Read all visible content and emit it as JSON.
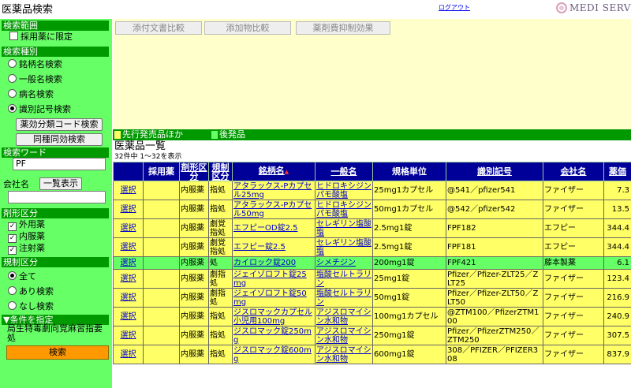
{
  "app": {
    "title": "医薬品検索",
    "logout": "ログアウト",
    "logo": "MEDI SERVE II"
  },
  "sidebar": {
    "scope": {
      "heading": "検索範囲",
      "adopted_only": "採用薬に限定"
    },
    "search_type": {
      "heading": "検索種別",
      "options": [
        "銘柄名検索",
        "一般名検索",
        "病名検索",
        "識別記号検索"
      ],
      "selected": "識別記号検索",
      "btn_efficacy": "薬効分類コード検索",
      "btn_same_kind": "同種同効検索"
    },
    "keyword": {
      "heading": "検索ワード",
      "value": "PF"
    },
    "company": {
      "label": "会社名",
      "btn_list": "一覧表示",
      "value": ""
    },
    "dosage_form": {
      "heading": "剤形区分",
      "options": [
        "外用薬",
        "内服薬",
        "注射薬"
      ]
    },
    "regulation": {
      "heading": "規制区分",
      "options": [
        "全て",
        "あり検索",
        "なし検索"
      ],
      "selected": "全て"
    },
    "conditions": {
      "heading": "▼条件を指定",
      "text": "局生特毒劇向覚麻習指要処"
    },
    "search_button": "検索"
  },
  "compare": {
    "buttons": [
      "添付文書比較",
      "添加物比較",
      "薬剤費抑制効果"
    ]
  },
  "legend": {
    "first_gen": "先行発売品ほか",
    "generic": "後発品",
    "first_gen_color": "#ffff66",
    "generic_color": "#66ff66"
  },
  "list": {
    "title": "医薬品一覧",
    "count": "32件中 1～32を表示"
  },
  "table": {
    "headers": {
      "select": "",
      "adopted": "採用薬",
      "form": "剤形区分",
      "regulation": "規制区分",
      "brand": "銘柄名",
      "generic": "一般名",
      "unit": "規格単位",
      "code": "識別記号",
      "company": "会社名",
      "price": "薬価"
    },
    "select_label": "選択",
    "rows": [
      {
        "form": "内服薬",
        "reg": "指処",
        "brand": "アタラックス-Pカプセル25mg",
        "generic": "ヒドロキシジンパモ酸塩",
        "unit": "25mg1カプセル",
        "code": "@541／pfizer541",
        "company": "ファイザー",
        "price": "7.3",
        "generic_flag": false
      },
      {
        "form": "内服薬",
        "reg": "指処",
        "brand": "アタラックス-Pカプセル50mg",
        "generic": "ヒドロキシジンパモ酸塩",
        "unit": "50mg1カプセル",
        "code": "@542／pfizer542",
        "company": "ファイザー",
        "price": "13.5",
        "generic_flag": false
      },
      {
        "form": "内服薬",
        "reg": "劇覚指処",
        "brand": "エフピーOD錠2.5",
        "generic": "セレギリン塩酸塩",
        "unit": "2.5mg1錠",
        "code": "FPF182",
        "company": "エフピー",
        "price": "344.4",
        "generic_flag": false
      },
      {
        "form": "内服薬",
        "reg": "劇覚指処",
        "brand": "エフピー錠2.5",
        "generic": "セレギリン塩酸塩",
        "unit": "2.5mg1錠",
        "code": "FPF181",
        "company": "エフピー",
        "price": "344.4",
        "generic_flag": false
      },
      {
        "form": "内服薬",
        "reg": "処",
        "brand": "カイロック錠200",
        "generic": "シメチジン",
        "unit": "200mg1錠",
        "code": "FPF421",
        "company": "藤本製薬",
        "price": "6.1",
        "generic_flag": true
      },
      {
        "form": "内服薬",
        "reg": "劇指処",
        "brand": "ジェイゾロフト錠25mg",
        "generic": "塩酸セルトラリン",
        "unit": "25mg1錠",
        "code": "Pfizer／Pfizer-ZLT25／ZLT25",
        "company": "ファイザー",
        "price": "123.4",
        "generic_flag": false
      },
      {
        "form": "内服薬",
        "reg": "劇指処",
        "brand": "ジェイゾロフト錠50mg",
        "generic": "塩酸セルトラリン",
        "unit": "50mg1錠",
        "code": "Pfizer／Pfizer-ZLT50／ZLT50",
        "company": "ファイザー",
        "price": "216.9",
        "generic_flag": false
      },
      {
        "form": "内服薬",
        "reg": "指処",
        "brand": "ジスロマックカプセル小児用100mg",
        "generic": "アジスロマイシン水和物",
        "unit": "100mg1カプセル",
        "code": "@ZTM100／PfizerZTM100",
        "company": "ファイザー",
        "price": "240.9",
        "generic_flag": false
      },
      {
        "form": "内服薬",
        "reg": "指処",
        "brand": "ジスロマック錠250mg",
        "generic": "アジスロマイシン水和物",
        "unit": "250mg1錠",
        "code": "Pfizer／PfizerZTM250／ZTM250",
        "company": "ファイザー",
        "price": "307.5",
        "generic_flag": false
      },
      {
        "form": "内服薬",
        "reg": "指処",
        "brand": "ジスロマック錠600mg",
        "generic": "アジスロマイシン水和物",
        "unit": "600mg1錠",
        "code": "308／PFIZER／PFIZER308",
        "company": "ファイザー",
        "price": "837.9",
        "generic_flag": false
      }
    ]
  }
}
